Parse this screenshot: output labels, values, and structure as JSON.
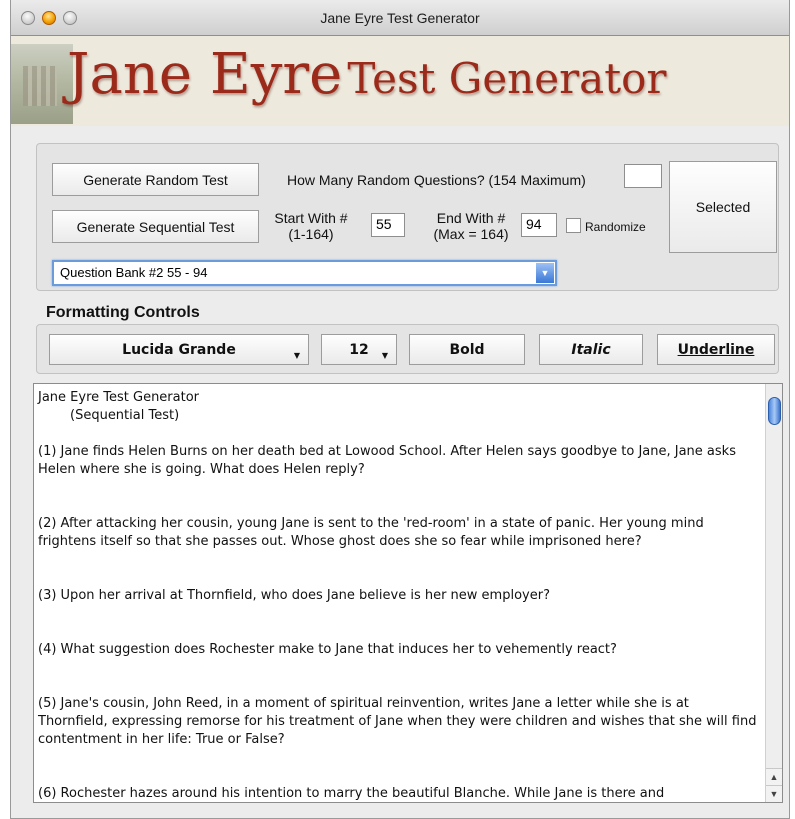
{
  "window": {
    "title": "Jane Eyre Test Generator"
  },
  "banner": {
    "title_big": "Jane Eyre",
    "title_small": "Test Generator"
  },
  "controls": {
    "random_button": "Generate Random Test",
    "random_label": "How Many Random Questions? (154 Maximum)",
    "random_value": "",
    "selected_button": "Selected",
    "sequential_button": "Generate Sequential Test",
    "start_label_line1": "Start With #",
    "start_label_line2": "(1-164)",
    "start_value": "55",
    "end_label_line1": "End With #",
    "end_label_line2": "(Max = 164)",
    "end_value": "94",
    "randomize_label": "Randomize",
    "randomize_checked": false,
    "question_bank": "Question Bank #2  55 - 94"
  },
  "formatting": {
    "section_title": "Formatting Controls",
    "font_name": "Lucida Grande",
    "font_size": "12",
    "bold": "Bold",
    "italic": "Italic",
    "underline": "Underline"
  },
  "document": {
    "heading": "Jane Eyre Test Generator",
    "subheading": "(Sequential Test)",
    "questions": [
      "(1)  Jane finds Helen Burns on her death bed at Lowood School. After Helen says goodbye to Jane, Jane asks Helen where she is going. What does Helen reply?",
      "(2)  After attacking her cousin, young Jane is sent to the 'red-room' in a state of panic. Her young mind frightens itself so that she passes out. Whose ghost does she so fear while imprisoned here?",
      "(3)  Upon her arrival at Thornfield, who does Jane believe is her new employer?",
      "(4)  What suggestion does Rochester make to Jane that induces her to vehemently react?",
      "(5)  Jane's cousin, John Reed, in a moment of spiritual reinvention, writes Jane a letter while she is at Thornfield, expressing remorse for his treatment of Jane when they were children and wishes that she will find contentment in her life: True or False?",
      "(6)  Rochester hazes around his intention to marry the beautiful Blanche. While Jane is there and"
    ]
  }
}
